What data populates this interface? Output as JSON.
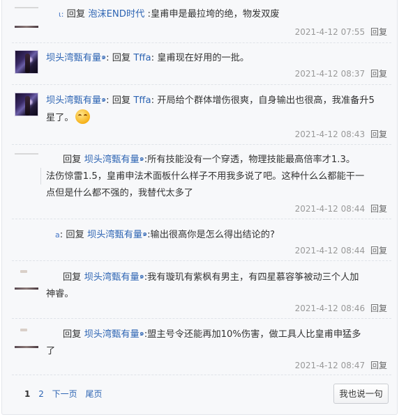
{
  "replies": [
    {
      "user": "",
      "prefix": "",
      "reply_word": "回复",
      "target": "泡沫END时代",
      "text": " :皇甫申是最拉垮的绝，物发双废",
      "time": "2021-4-12 07:55",
      "action": "回复"
    },
    {
      "user": "坝头湾甄有量",
      "reply_word": "回复",
      "target": "Tffa",
      "text": ": 皇甫现在好用的一批。",
      "time": "2021-4-12 08:37",
      "action": "回复"
    },
    {
      "user": "坝头湾甄有量",
      "reply_word": "回复",
      "target": "Tffa",
      "text_line1": ": 开局给个群体增伤很爽，自身输出也很高，我准备升5",
      "text_line2": "星了。",
      "time": "2021-4-12 08:43",
      "action": "回复"
    },
    {
      "reply_word": "回复",
      "target": "坝头湾甄有量",
      "text_line1": ":所有技能没有一个穿透，物理技能最高倍率才1.3。",
      "text_line2": "法伤惊雷1.5，皇甫申法术面板什么样子不用我多说了吧。这种什么么都能干一",
      "text_line3": "点但是什么都不强的，我替代太多了",
      "time": "2021-4-12 08:44",
      "action": "回复"
    },
    {
      "prefix": "a",
      "reply_word": "回复",
      "target": "坝头湾甄有量",
      "text": ":输出很高你是怎么得出结论的?",
      "time": "2021-4-12 08:44",
      "action": "回复"
    },
    {
      "reply_word": "回复",
      "target": "坝头湾甄有量",
      "text_line1": ":我有璇玑有紫枫有男主，有四星慕容筝被动三个人加",
      "text_line2": "神睿。",
      "time": "2021-4-12 08:46",
      "action": "回复"
    },
    {
      "reply_word": "回复",
      "target": "坝头湾甄有量",
      "text_line1": ":盟主号令还能再加10%伤害，做工具人比皇甫申猛多",
      "text_line2": "了",
      "time": "2021-4-12 08:47",
      "action": "回复"
    }
  ],
  "pagination": {
    "page1": "1",
    "page2": "2",
    "next": "下一页",
    "last": "尾页"
  },
  "say_button": "我也说一句"
}
